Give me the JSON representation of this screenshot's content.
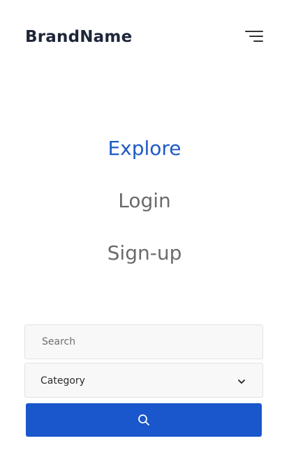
{
  "header": {
    "brand": "BrandName",
    "menu_icon": "hamburger-menu-icon"
  },
  "nav": {
    "items": [
      {
        "label": "Explore",
        "active": true
      },
      {
        "label": "Login",
        "active": false
      },
      {
        "label": "Sign-up",
        "active": false
      }
    ]
  },
  "search": {
    "placeholder": "Search",
    "value": "",
    "category_label": "Category",
    "chevron_icon": "chevron-down-icon",
    "button_icon": "search-icon"
  },
  "colors": {
    "brand_text": "#1e2639",
    "accent": "#1a56cc",
    "active_link": "#1f5ac4",
    "link": "#6b6b6b",
    "field_bg": "#f8f8f8",
    "field_border": "#e2e2e2"
  }
}
